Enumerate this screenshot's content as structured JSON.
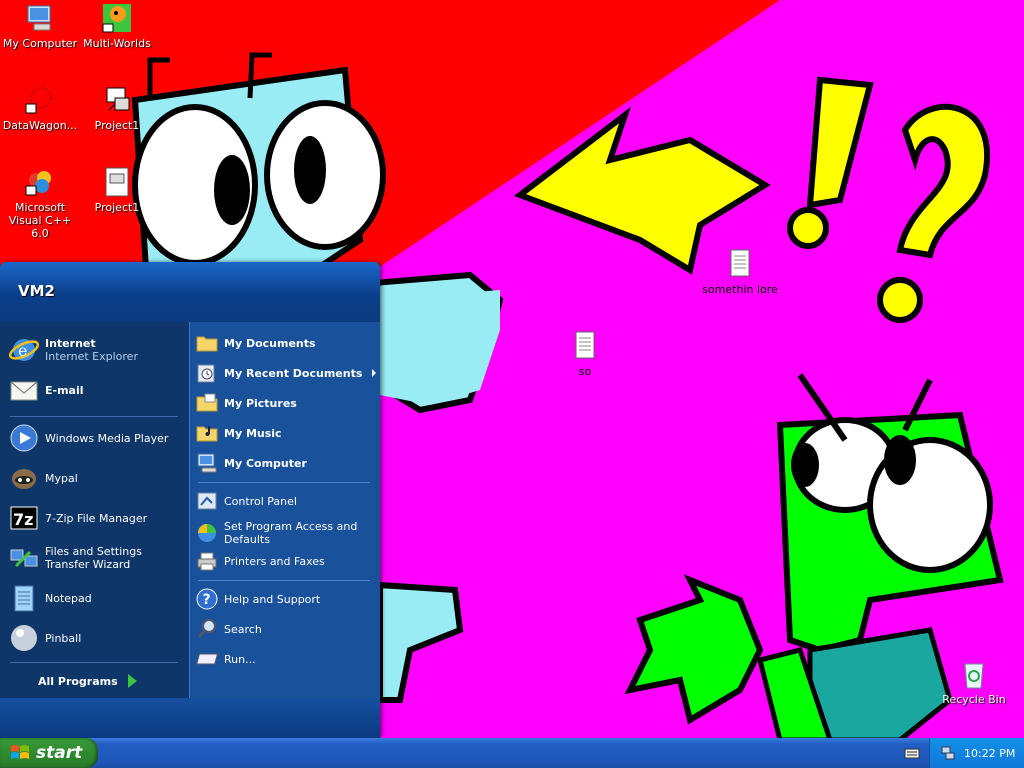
{
  "desktop": {
    "icons": [
      {
        "label": "My Computer",
        "icon": "my-computer-icon"
      },
      {
        "label": "Multi-Worlds",
        "icon": "shortcut-icon"
      },
      {
        "label": "DataWagon...",
        "icon": "shortcut-icon"
      },
      {
        "label": "Project1",
        "icon": "vb-project-icon"
      },
      {
        "label": "Microsoft Visual C++ 6.0",
        "icon": "visual-cpp-icon"
      },
      {
        "label": "Project1",
        "icon": "vb-project-icon"
      },
      {
        "label": "somethin lore",
        "icon": "text-file-icon"
      },
      {
        "label": "so",
        "icon": "text-file-icon"
      },
      {
        "label": "Recycle Bin",
        "icon": "recycle-bin-icon"
      }
    ]
  },
  "start_menu": {
    "user": "VM2",
    "pinned": [
      {
        "label": "Internet",
        "sub": "Internet Explorer",
        "icon": "internet-explorer-icon"
      },
      {
        "label": "E-mail",
        "icon": "email-icon"
      }
    ],
    "recent": [
      {
        "label": "Windows Media Player",
        "icon": "media-player-icon"
      },
      {
        "label": "Mypal",
        "icon": "mypal-icon"
      },
      {
        "label": "7-Zip File Manager",
        "icon": "7zip-icon"
      },
      {
        "label": "Files and Settings Transfer Wizard",
        "icon": "transfer-wizard-icon"
      },
      {
        "label": "Notepad",
        "icon": "notepad-icon"
      },
      {
        "label": "Pinball",
        "icon": "pinball-icon"
      }
    ],
    "all_programs": "All Programs",
    "right": [
      {
        "label": "My Documents",
        "icon": "folder-icon"
      },
      {
        "label": "My Recent Documents",
        "icon": "recent-docs-icon"
      },
      {
        "label": "My Pictures",
        "icon": "pictures-folder-icon"
      },
      {
        "label": "My Music",
        "icon": "music-folder-icon"
      },
      {
        "label": "My Computer",
        "icon": "my-computer-icon"
      },
      {
        "label": "Control Panel",
        "icon": "control-panel-icon"
      },
      {
        "label": "Set Program Access and Defaults",
        "icon": "program-access-icon"
      },
      {
        "label": "Printers and Faxes",
        "icon": "printer-icon"
      },
      {
        "label": "Help and Support",
        "icon": "help-icon"
      },
      {
        "label": "Search",
        "icon": "search-icon"
      },
      {
        "label": "Run...",
        "icon": "run-icon"
      }
    ]
  },
  "taskbar": {
    "start_label": "start",
    "clock": "10:22 PM"
  }
}
